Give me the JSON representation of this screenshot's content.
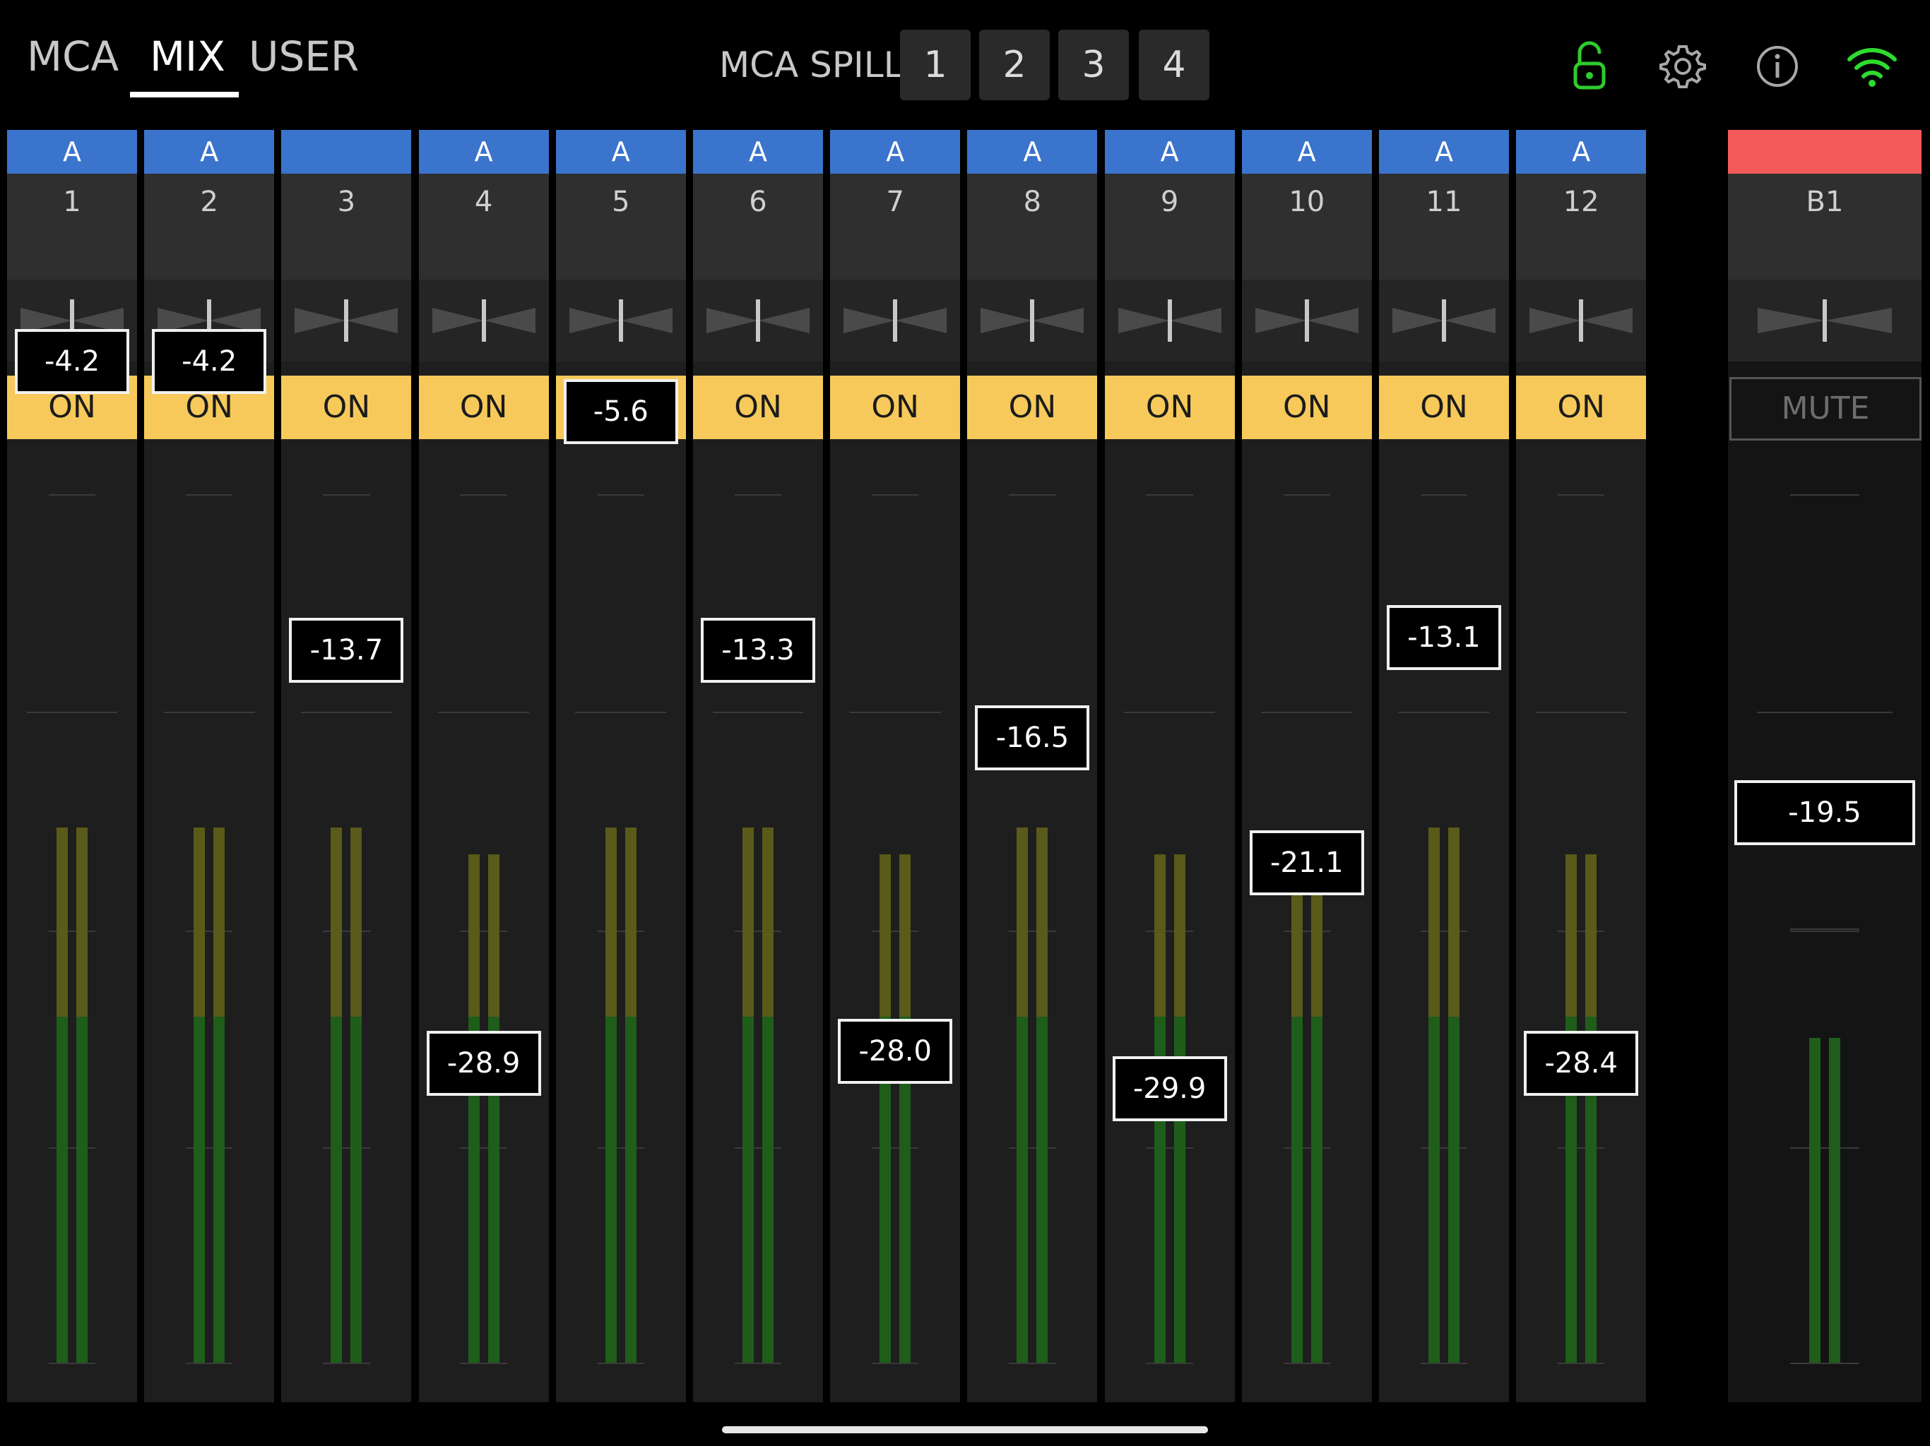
{
  "nav": {
    "tabs": [
      {
        "label": "MCA",
        "active": false
      },
      {
        "label": "MIX",
        "active": true
      },
      {
        "label": "USER",
        "active": false
      }
    ]
  },
  "spill": {
    "label": "MCA SPILL",
    "buttons": [
      "1",
      "2",
      "3",
      "4"
    ]
  },
  "icons": {
    "lock": "unlock-icon",
    "settings": "gear-icon",
    "info": "info-icon",
    "wifi": "wifi-icon"
  },
  "colors": {
    "group_blue": "#3b74cc",
    "master_red": "#f55a5a",
    "on_yellow": "#f6c95a",
    "lock_green": "#2ecb2e",
    "wifi_green": "#2edc2e",
    "meter_green": "#1e5e1a",
    "meter_olive": "#5a5a1a"
  },
  "strips": [
    {
      "group": "A",
      "name": "1",
      "on": "ON",
      "value": "-4.2",
      "level": 0.89
    },
    {
      "group": "A",
      "name": "2",
      "on": "ON",
      "value": "-4.2",
      "level": 0.89
    },
    {
      "group": "",
      "name": "3",
      "on": "ON",
      "value": "-13.7",
      "level": 0.66
    },
    {
      "group": "A",
      "name": "4",
      "on": "ON",
      "value": "-28.9",
      "level": 0.33
    },
    {
      "group": "A",
      "name": "5",
      "on": "ON",
      "value": "-5.6",
      "level": 0.85
    },
    {
      "group": "A",
      "name": "6",
      "on": "ON",
      "value": "-13.3",
      "level": 0.66
    },
    {
      "group": "A",
      "name": "7",
      "on": "ON",
      "value": "-28.0",
      "level": 0.34
    },
    {
      "group": "A",
      "name": "8",
      "on": "ON",
      "value": "-16.5",
      "level": 0.59
    },
    {
      "group": "A",
      "name": "9",
      "on": "ON",
      "value": "-29.9",
      "level": 0.31
    },
    {
      "group": "A",
      "name": "10",
      "on": "ON",
      "value": "-21.1",
      "level": 0.49
    },
    {
      "group": "A",
      "name": "11",
      "on": "ON",
      "value": "-13.1",
      "level": 0.67
    },
    {
      "group": "A",
      "name": "12",
      "on": "ON",
      "value": "-28.4",
      "level": 0.33
    }
  ],
  "master": {
    "name": "B1",
    "mute": "MUTE",
    "value": "-19.5",
    "level": 0.53
  }
}
